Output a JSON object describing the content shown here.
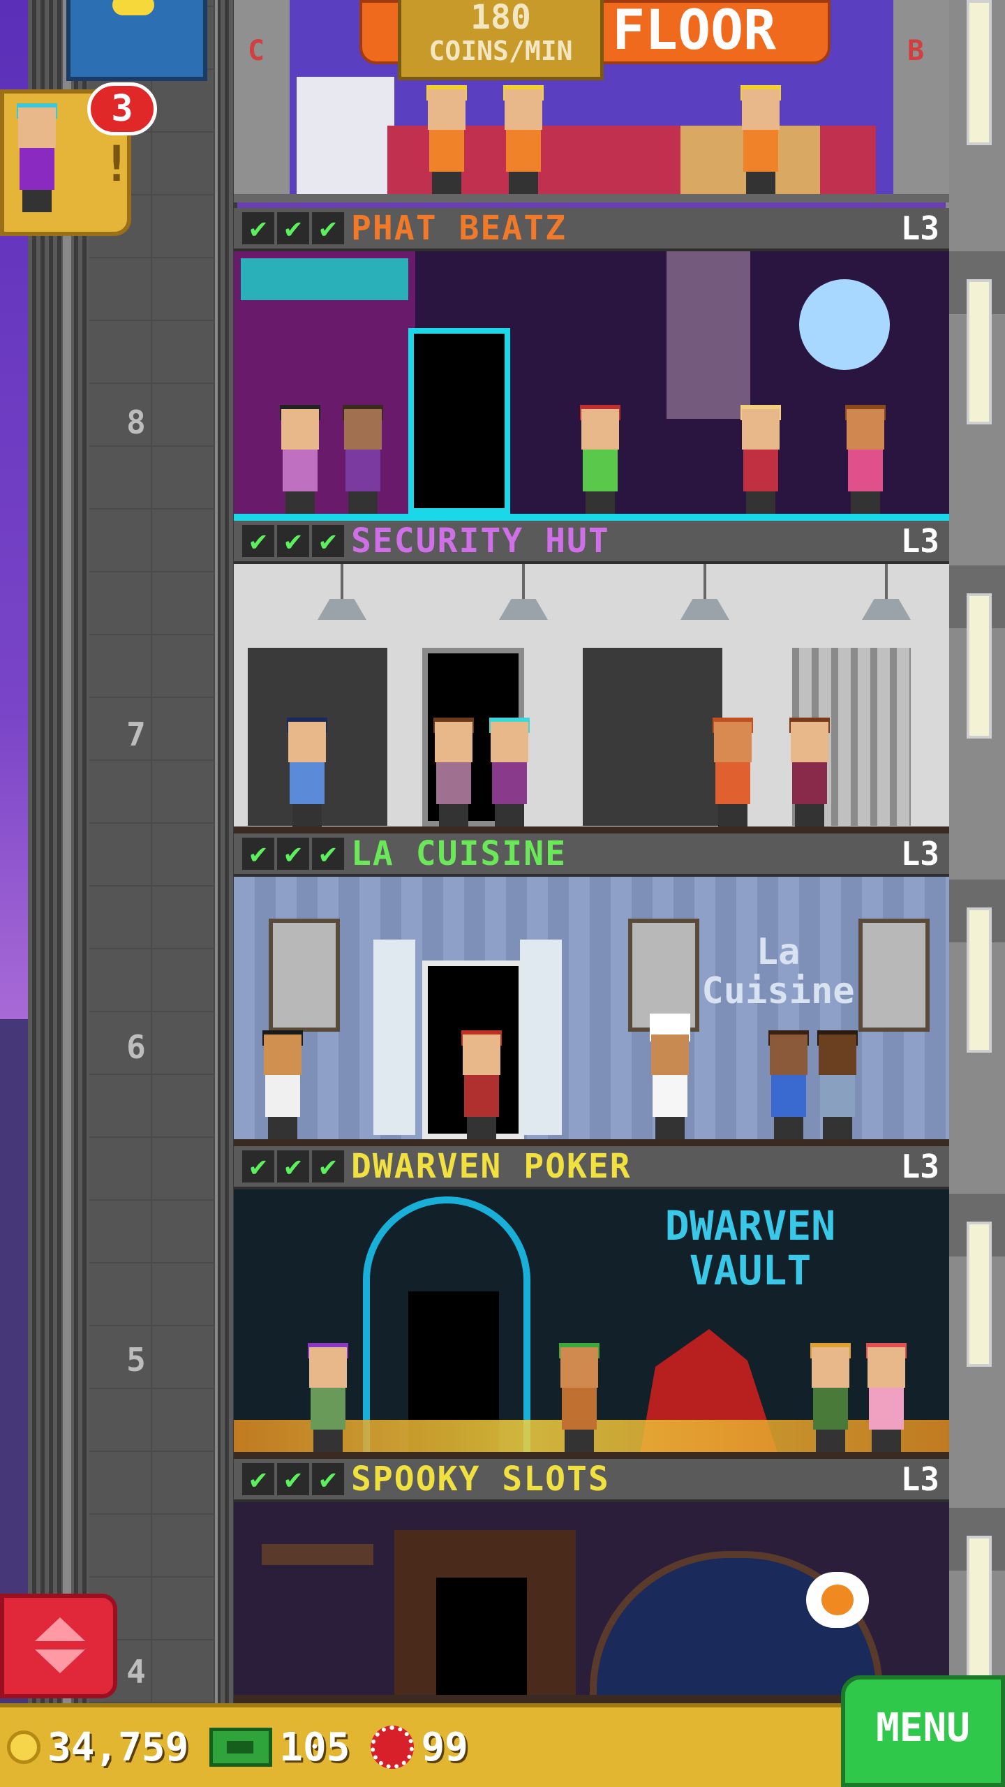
{
  "top_floor": {
    "rush_banner": "FLOOR",
    "coin_rate_value": "180",
    "coin_rate_label": "COINS/MIN",
    "pillar_left_letter": "C",
    "pillar_right_letter": "B"
  },
  "visitor": {
    "badge_count": "3",
    "exclaim": "!"
  },
  "floors": [
    {
      "name": "PHAT BEATZ",
      "level": "L3",
      "number": "8",
      "name_color": "#f07a2a",
      "bg": "#2a1540"
    },
    {
      "name": "SECURITY HUT",
      "level": "L3",
      "number": "7",
      "name_color": "#d070e8",
      "bg": "#d9d9d9"
    },
    {
      "name": "LA CUISINE",
      "level": "L3",
      "number": "6",
      "name_color": "#6ae85a",
      "bg": "#8fa0c8"
    },
    {
      "name": "DWARVEN POKER",
      "level": "L3",
      "number": "5",
      "name_color": "#f0e040",
      "bg": "#12202a"
    },
    {
      "name": "SPOOKY SLOTS",
      "level": "L3",
      "number": "4",
      "name_color": "#f0e040",
      "bg": "#2a1e3a"
    }
  ],
  "check_glyph": "✔",
  "signs": {
    "la_cuisine": "La\nCuisine",
    "dwarven_vault_1": "DWARVEN",
    "dwarven_vault_2": "VAULT"
  },
  "currency": {
    "coins": "34,759",
    "bux": "105",
    "tokens": "99"
  },
  "menu_label": "MENU",
  "icons": [
    "coin-icon",
    "bux-icon",
    "token-icon",
    "elevator-up-down-icon",
    "checkmark-icon"
  ]
}
